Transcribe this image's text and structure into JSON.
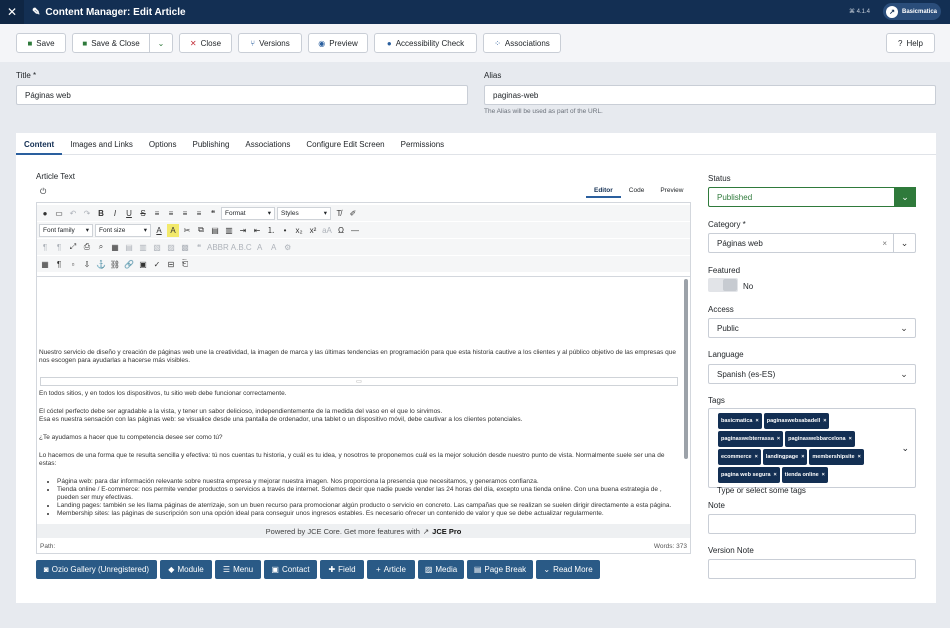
{
  "header": {
    "title": "Content Manager: Edit Article",
    "version": "⌘ 4.1.4",
    "user": "Basicmatica"
  },
  "toolbar": {
    "save": "Save",
    "save_close": "Save & Close",
    "close": "Close",
    "versions": "Versions",
    "preview": "Preview",
    "accessibility": "Accessibility Check",
    "associations": "Associations",
    "help": "Help"
  },
  "form": {
    "title_label": "Title *",
    "title_value": "Páginas web",
    "alias_label": "Alias",
    "alias_value": "paginas-web",
    "alias_hint": "The Alias will be used as part of the URL."
  },
  "tabs": [
    "Content",
    "Images and Links",
    "Options",
    "Publishing",
    "Associations",
    "Configure Edit Screen",
    "Permissions"
  ],
  "editor": {
    "label": "Article Text",
    "modes": [
      "Editor",
      "Code",
      "Preview"
    ],
    "format": "Format",
    "styles": "Styles",
    "font_family": "Font family",
    "font_size": "Font size",
    "paragraphs": [
      "Nuestro servicio de diseño y creación de páginas web une la creatividad, la imagen de marca y las últimas tendencias en programación para que esta historia cautive a los clientes y al público objetivo de las empresas que nos escogen para ayudarlas a hacerse más visibles.",
      "En todos sitios, y en todos los dispositivos, tu sitio web debe funcionar correctamente.",
      "El cóctel perfecto debe ser agradable a la vista, y tener un sabor delicioso, independientemente de la medida del vaso en el que lo sirvimos.",
      "Esa es nuestra sensación con las páginas web: se visualice desde una pantalla de ordenador, una tablet o un dispositivo móvil, debe cautivar a los clientes potenciales.",
      "¿Te ayudamos a hacer que tu competencia desee ser como tú?",
      "Lo hacemos de una forma que te resulta sencilla y efectiva: tú nos cuentas tu historia, y cuál es tu idea, y nosotros te proponemos cuál es la mejor solución desde nuestro punto de vista. Normalmente suele ser una de estas:"
    ],
    "bullets": [
      "Página web: para dar información relevante sobre nuestra empresa y mejorar nuestra imagen. Nos proporciona la presencia que necesitamos, y generamos confianza.",
      "Tienda online / E-commerce: nos permite vender productos o servicios a través de internet. Solemos decir que nadie puede vender las 24 horas del día, excepto una tienda online. Con una buena estrategia de                 , pueden ser muy efectivas.",
      "Landing pages: también se les llama páginas de aterrizaje, son un buen recurso para promocionar algún producto o servicio en concreto. Las campañas que se realizan se suelen dirigir directamente a esta página.",
      "Membership sites: las páginas de suscripción son una opción ideal para conseguir unos ingresos estables. Es necesario ofrecer un contenido de valor y que se debe actualizar regularmente."
    ],
    "powered": "Powered by JCE Core. Get more features with",
    "jce_pro": "JCE Pro",
    "path": "Path:",
    "words": "Words: 373"
  },
  "extra_buttons": [
    "Ozio Gallery (Unregistered)",
    "Module",
    "Menu",
    "Contact",
    "Field",
    "Article",
    "Media",
    "Page Break",
    "Read More"
  ],
  "sidebar": {
    "status_label": "Status",
    "status_value": "Published",
    "category_label": "Category *",
    "category_value": "Páginas web",
    "featured_label": "Featured",
    "featured_value": "No",
    "access_label": "Access",
    "access_value": "Public",
    "language_label": "Language",
    "language_value": "Spanish (es-ES)",
    "tags_label": "Tags",
    "tags": [
      "basicmatica",
      "paginaswebsabadell",
      "paginaswebterrassa",
      "paginaswebbarcelona",
      "ecommerce",
      "landingpage",
      "membershipsite",
      "pagina web segura",
      "tienda online"
    ],
    "tags_placeholder": "Type or select some tags",
    "note_label": "Note",
    "version_note_label": "Version Note"
  },
  "colors": {
    "header": "#132f53",
    "status_green": "#2f7a3b",
    "button_blue": "#2a5a86"
  }
}
